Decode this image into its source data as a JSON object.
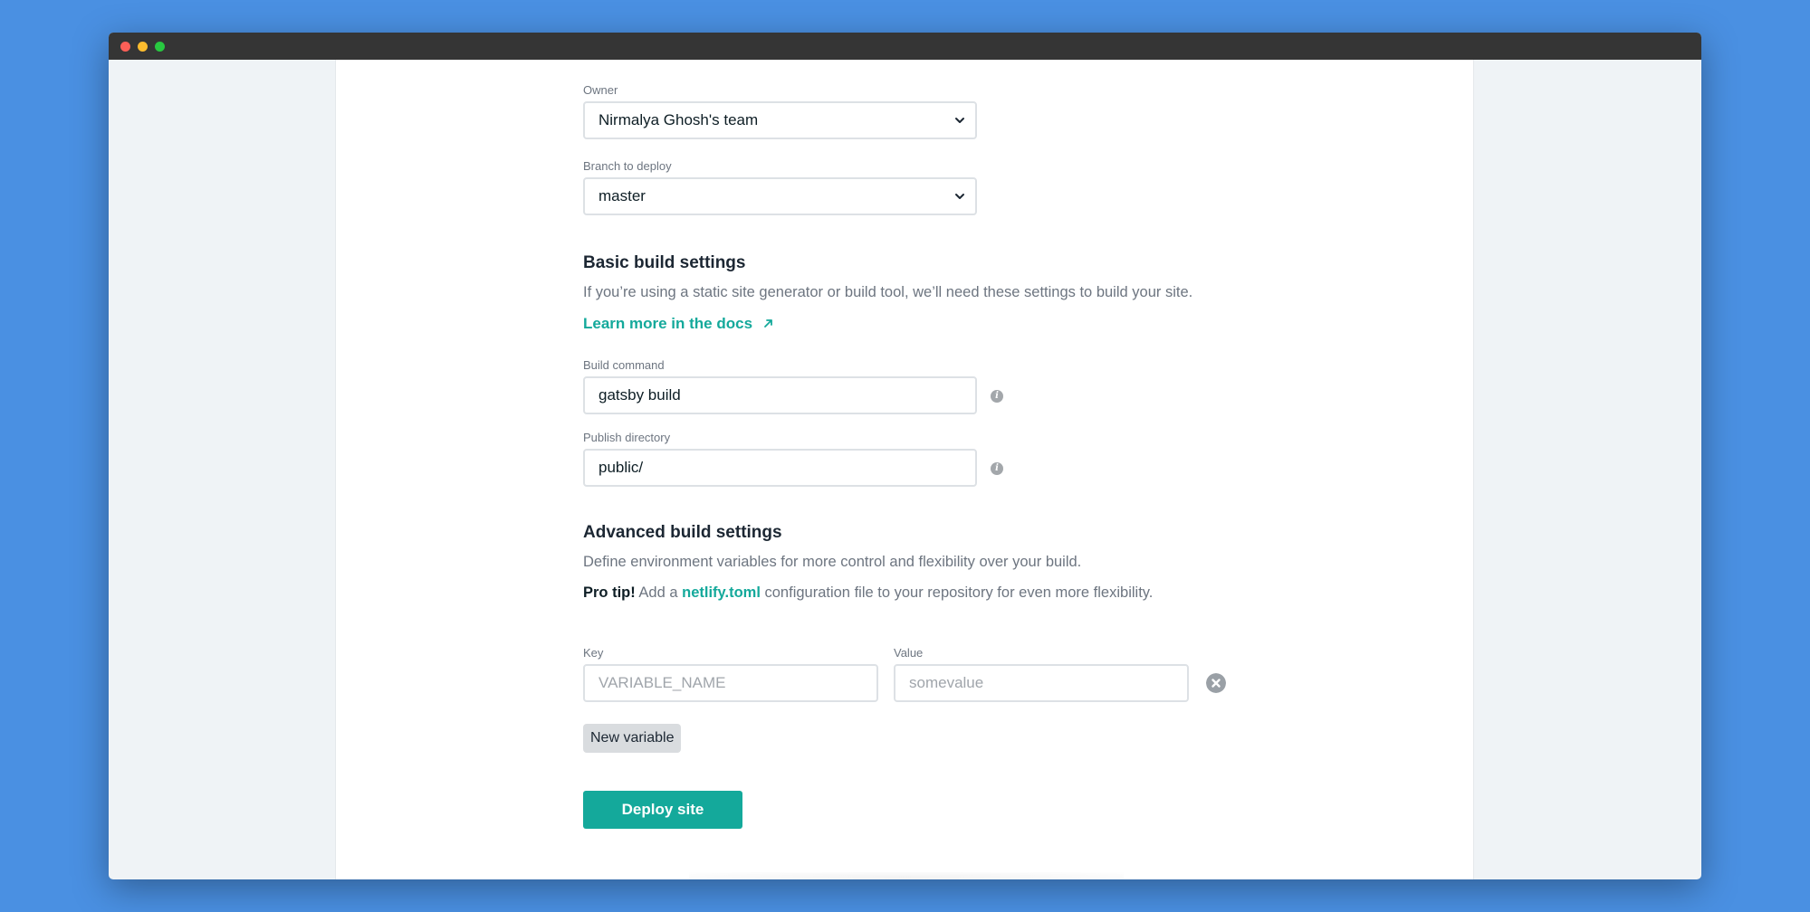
{
  "window": {
    "controls": [
      "close",
      "minimize",
      "maximize"
    ]
  },
  "owner": {
    "label": "Owner",
    "value": "Nirmalya Ghosh's team"
  },
  "branch": {
    "label": "Branch to deploy",
    "value": "master"
  },
  "basic": {
    "title": "Basic build settings",
    "description": "If you’re using a static site generator or build tool, we’ll need these settings to build your site.",
    "docs_link": "Learn more in the docs",
    "docs_link_icon": "arrow-up-right-icon",
    "build_command_label": "Build command",
    "build_command_value": "gatsby build",
    "publish_dir_label": "Publish directory",
    "publish_dir_value": "public/"
  },
  "advanced": {
    "title": "Advanced build settings",
    "description": "Define environment variables for more control and flexibility over your build.",
    "pro_tip_strong": "Pro tip!",
    "pro_tip_before": " Add a ",
    "pro_tip_link": "netlify.toml",
    "pro_tip_after": " configuration file to your repository for even more flexibility.",
    "key_label": "Key",
    "key_placeholder": "VARIABLE_NAME",
    "value_label": "Value",
    "value_placeholder": "somevalue",
    "new_variable_button": "New variable"
  },
  "deploy_button": "Deploy site",
  "colors": {
    "accent": "#14a99b",
    "background": "#4a90e2"
  }
}
